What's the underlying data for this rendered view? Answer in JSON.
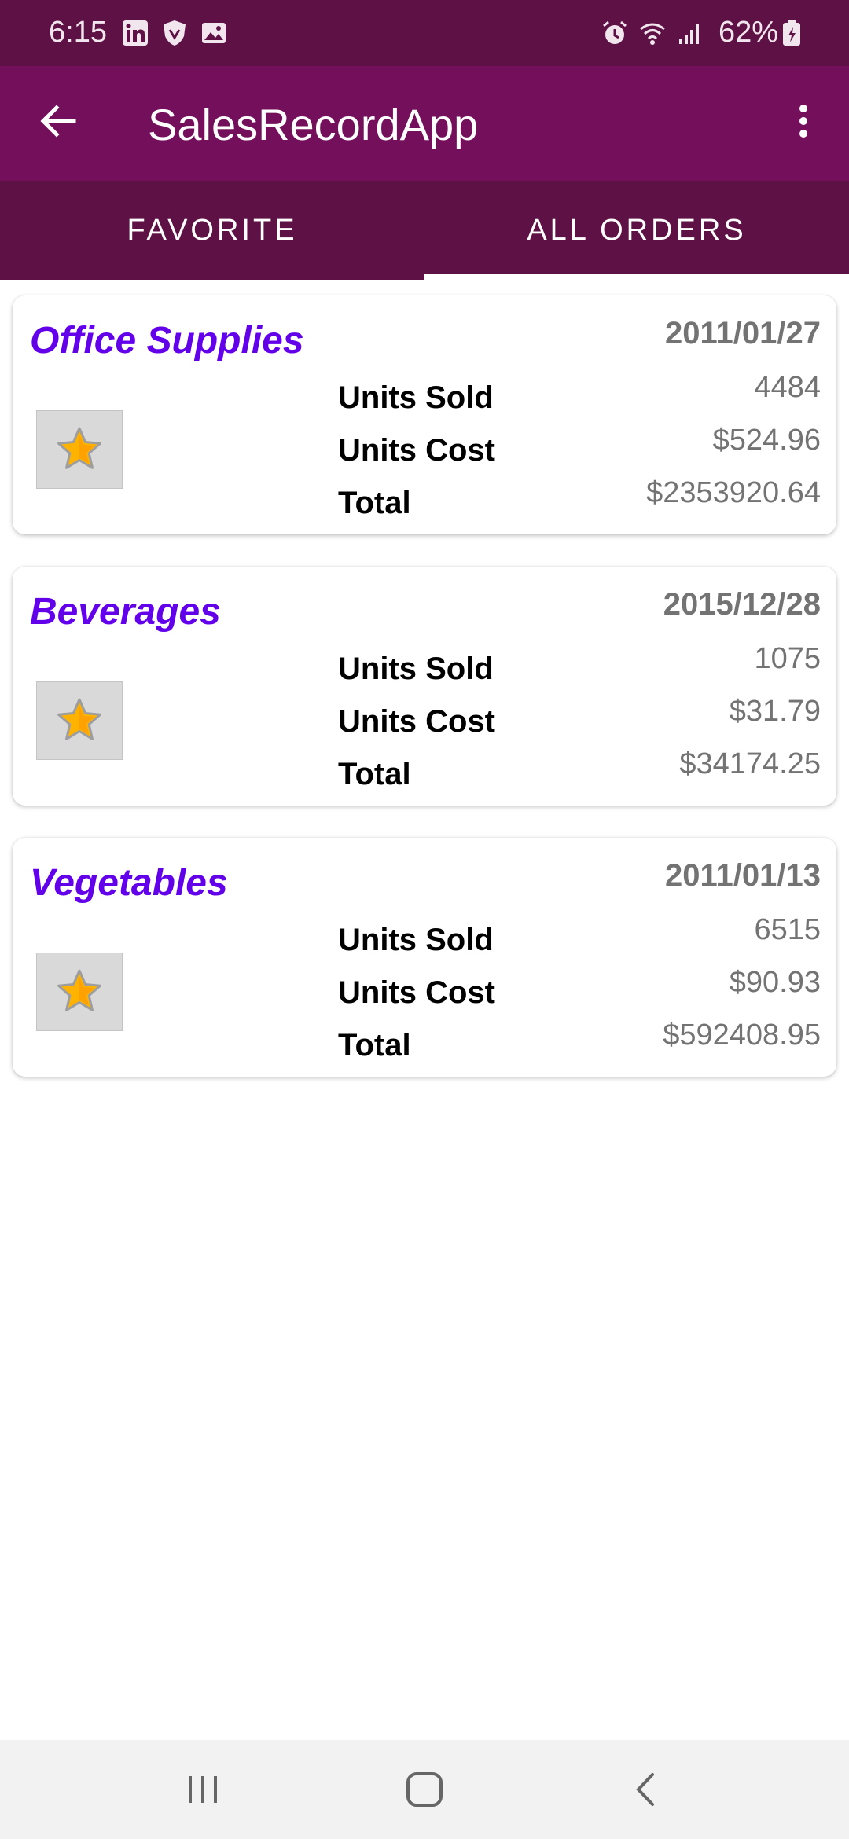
{
  "status_bar": {
    "time": "6:15",
    "battery_percent": "62%",
    "icons": [
      "linkedin-icon",
      "brave-shield-icon",
      "image-icon",
      "alarm-icon",
      "wifi-icon",
      "signal-icon",
      "battery-icon"
    ]
  },
  "app_bar": {
    "title": "SalesRecordApp",
    "back_icon": "arrow-left-icon",
    "menu_icon": "more-vertical-icon"
  },
  "tabs": [
    {
      "label": "FAVORITE",
      "selected": false
    },
    {
      "label": "ALL ORDERS",
      "selected": true
    }
  ],
  "labels": {
    "units_sold": "Units Sold",
    "units_cost": "Units Cost",
    "total": "Total"
  },
  "orders": [
    {
      "category": "Office Supplies",
      "date": "2011/01/27",
      "units_sold": "4484",
      "units_cost": "$524.96",
      "total": "$2353920.64",
      "favorite": true
    },
    {
      "category": "Beverages",
      "date": "2015/12/28",
      "units_sold": "1075",
      "units_cost": "$31.79",
      "total": "$34174.25",
      "favorite": true
    },
    {
      "category": "Vegetables",
      "date": "2011/01/13",
      "units_sold": "6515",
      "units_cost": "$90.93",
      "total": "$592408.95",
      "favorite": true
    }
  ],
  "colors": {
    "status_bar": "#5e1145",
    "app_bar": "#740f5b",
    "tab_bar": "#5e1145",
    "category_text": "#6200ea",
    "value_text": "#737373"
  },
  "nav_bar": {
    "icons": [
      "recent-apps-icon",
      "home-icon",
      "back-nav-icon"
    ]
  }
}
